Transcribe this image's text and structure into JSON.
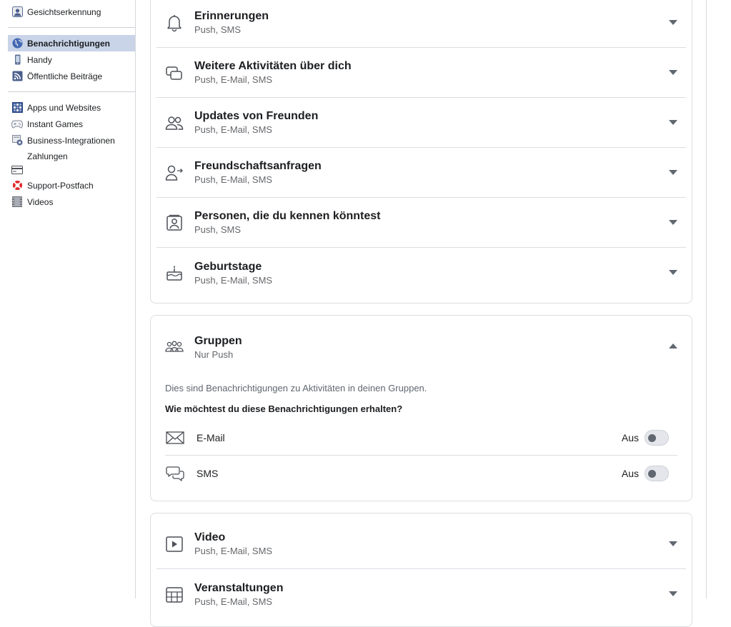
{
  "sidebar": {
    "items_top": [
      {
        "label": "Gesichtserkennung",
        "icon": "face-recognition-icon"
      }
    ],
    "items_mid": [
      {
        "label": "Benachrichtigungen",
        "icon": "globe-icon",
        "active": true
      },
      {
        "label": "Handy",
        "icon": "phone-icon"
      },
      {
        "label": "Öffentliche Beiträge",
        "icon": "rss-icon"
      }
    ],
    "items_bottom": [
      {
        "label": "Apps und Websites",
        "icon": "apps-icon"
      },
      {
        "label": "Instant Games",
        "icon": "gamepad-icon"
      },
      {
        "label": "Business-Integrationen",
        "icon": "business-gear-icon"
      },
      {
        "label": "Zahlungen",
        "icon": "credit-card-icon"
      },
      {
        "label": "Support-Postfach",
        "icon": "lifebuoy-icon"
      },
      {
        "label": "Videos",
        "icon": "film-icon"
      }
    ]
  },
  "card1": {
    "rows": [
      {
        "title": "Erinnerungen",
        "sub": "Push, SMS",
        "icon": "bell-icon"
      },
      {
        "title": "Weitere Aktivitäten über dich",
        "sub": "Push, E-Mail, SMS",
        "icon": "activity-windows-icon"
      },
      {
        "title": "Updates von Freunden",
        "sub": "Push, E-Mail, SMS",
        "icon": "friends-icon"
      },
      {
        "title": "Freundschaftsanfragen",
        "sub": "Push, E-Mail, SMS",
        "icon": "friend-request-icon"
      },
      {
        "title": "Personen, die du kennen könntest",
        "sub": "Push, SMS",
        "icon": "person-card-icon"
      },
      {
        "title": "Geburtstage",
        "sub": "Push, E-Mail, SMS",
        "icon": "birthday-cake-icon"
      }
    ]
  },
  "groups": {
    "title": "Gruppen",
    "sub": "Nur Push",
    "icon": "groups-icon",
    "description": "Dies sind Benachrichtigungen zu Aktivitäten in deinen Gruppen.",
    "question": "Wie möchtest du diese Benachrichtigungen erhalten?",
    "options": [
      {
        "label": "E-Mail",
        "state": "Aus",
        "icon": "envelope-icon",
        "on": false
      },
      {
        "label": "SMS",
        "state": "Aus",
        "icon": "chat-bubbles-icon",
        "on": false
      }
    ]
  },
  "card3": {
    "rows": [
      {
        "title": "Video",
        "sub": "Push, E-Mail, SMS",
        "icon": "video-play-icon"
      },
      {
        "title": "Veranstaltungen",
        "sub": "Push, E-Mail, SMS",
        "icon": "calendar-icon"
      }
    ]
  }
}
